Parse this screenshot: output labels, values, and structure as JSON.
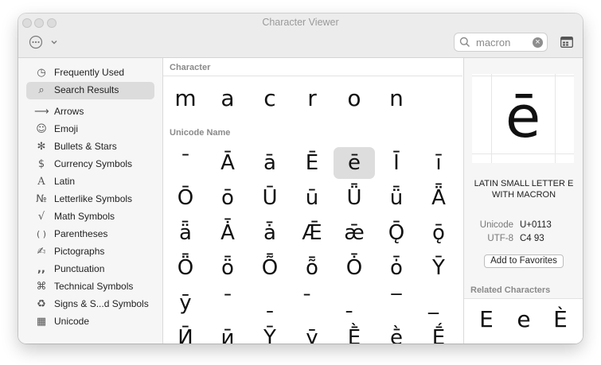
{
  "window": {
    "title": "Character Viewer"
  },
  "search": {
    "value": "macron",
    "clear_glyph": "×"
  },
  "sidebar": {
    "items": [
      {
        "label": "Frequently Used",
        "icon": "◷",
        "icon_name": "clock-icon"
      },
      {
        "label": "Search Results",
        "icon": "⌕",
        "icon_name": "magnifier-icon",
        "selected": true
      },
      {
        "label": "Arrows",
        "icon": "⟶",
        "icon_name": "arrow-icon"
      },
      {
        "label": "Emoji",
        "icon": "☺",
        "icon_name": "smiley-icon"
      },
      {
        "label": "Bullets & Stars",
        "icon": "✻",
        "icon_name": "asterisk-icon"
      },
      {
        "label": "Currency Symbols",
        "icon": "$",
        "icon_name": "dollar-icon"
      },
      {
        "label": "Latin",
        "icon": "A",
        "icon_name": "latin-letter-icon"
      },
      {
        "label": "Letterlike Symbols",
        "icon": "№",
        "icon_name": "numero-icon"
      },
      {
        "label": "Math Symbols",
        "icon": "√",
        "icon_name": "square-root-icon"
      },
      {
        "label": "Parentheses",
        "icon": "( )",
        "icon_name": "parentheses-icon"
      },
      {
        "label": "Pictographs",
        "icon": "✍",
        "icon_name": "pictograph-icon"
      },
      {
        "label": "Punctuation",
        "icon": ",,",
        "icon_name": "punctuation-icon"
      },
      {
        "label": "Technical Symbols",
        "icon": "⌘",
        "icon_name": "command-key-icon"
      },
      {
        "label": "Signs & S...d Symbols",
        "icon": "♻",
        "icon_name": "recycle-icon"
      },
      {
        "label": "Unicode",
        "icon": "▦",
        "icon_name": "unicode-grid-icon"
      }
    ]
  },
  "character_section": {
    "heading": "Character",
    "chars": [
      "m",
      "a",
      "c",
      "r",
      "o",
      "n"
    ]
  },
  "unicode_section": {
    "heading": "Unicode Name",
    "rows": [
      [
        "¯",
        "Ā",
        "ā",
        "Ē",
        "ē",
        "Ī",
        "ī"
      ],
      [
        "Ō",
        "ō",
        "Ū",
        "ū",
        "Ǖ",
        "ǖ",
        "Ǟ"
      ],
      [
        "ǟ",
        "Ǡ",
        "ǡ",
        "Ǣ",
        "ǣ",
        "Ǭ",
        "ǭ"
      ],
      [
        "Ȫ",
        "ȫ",
        "Ȭ",
        "ȭ",
        "Ȱ",
        "ȱ",
        "Ȳ"
      ],
      [
        "ȳ",
        "ˉ",
        "ˍ",
        "̄",
        "̱",
        "‾",
        "̲"
      ],
      [
        "Ӣ",
        "ӣ",
        "Ȳ",
        "ȳ",
        "Ḕ",
        "ḕ",
        "Ḗ"
      ]
    ],
    "selected_char": "ē"
  },
  "detail": {
    "char": "ē",
    "name": "LATIN SMALL LETTER E WITH MACRON",
    "unicode_label": "Unicode",
    "unicode_value": "U+0113",
    "utf8_label": "UTF-8",
    "utf8_value": "C4 93",
    "favorites_button": "Add to Favorites",
    "related_heading": "Related Characters",
    "related": [
      "E",
      "e",
      "È"
    ]
  },
  "colors": {
    "selection": "#dddddd",
    "titlebar": "#ececec",
    "sidebar_bg": "#f6f6f6",
    "section_heading": "#8a8a8a"
  }
}
